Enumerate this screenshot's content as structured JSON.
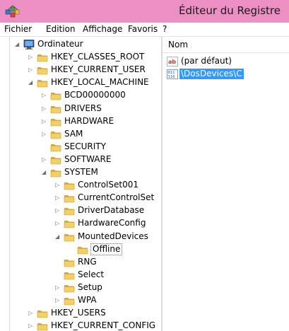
{
  "window": {
    "title": "Éditeur du Registre",
    "icon": "registry-editor-icon",
    "titlebar_color": "#ec8fc5"
  },
  "menu": [
    "Fichier",
    "Edition",
    "Affichage",
    "Favoris",
    "?"
  ],
  "tree": [
    {
      "label": "Ordinateur",
      "depth": 0,
      "state": "expanded",
      "icon": "computer-icon"
    },
    {
      "label": "HKEY_CLASSES_ROOT",
      "depth": 1,
      "state": "collapsed",
      "icon": "folder-icon"
    },
    {
      "label": "HKEY_CURRENT_USER",
      "depth": 1,
      "state": "collapsed",
      "icon": "folder-icon"
    },
    {
      "label": "HKEY_LOCAL_MACHINE",
      "depth": 1,
      "state": "expanded",
      "icon": "folder-icon"
    },
    {
      "label": "BCD00000000",
      "depth": 2,
      "state": "collapsed",
      "icon": "folder-icon"
    },
    {
      "label": "DRIVERS",
      "depth": 2,
      "state": "collapsed",
      "icon": "folder-icon"
    },
    {
      "label": "HARDWARE",
      "depth": 2,
      "state": "collapsed",
      "icon": "folder-icon"
    },
    {
      "label": "SAM",
      "depth": 2,
      "state": "collapsed",
      "icon": "folder-icon"
    },
    {
      "label": "SECURITY",
      "depth": 2,
      "state": "none",
      "icon": "folder-icon"
    },
    {
      "label": "SOFTWARE",
      "depth": 2,
      "state": "collapsed",
      "icon": "folder-icon"
    },
    {
      "label": "SYSTEM",
      "depth": 2,
      "state": "expanded",
      "icon": "folder-icon"
    },
    {
      "label": "ControlSet001",
      "depth": 3,
      "state": "collapsed",
      "icon": "folder-icon"
    },
    {
      "label": "CurrentControlSet",
      "depth": 3,
      "state": "collapsed",
      "icon": "folder-icon"
    },
    {
      "label": "DriverDatabase",
      "depth": 3,
      "state": "collapsed",
      "icon": "folder-icon"
    },
    {
      "label": "HardwareConfig",
      "depth": 3,
      "state": "collapsed",
      "icon": "folder-icon"
    },
    {
      "label": "MountedDevices",
      "depth": 3,
      "state": "expanded",
      "icon": "folder-icon"
    },
    {
      "label": "Offline",
      "depth": 4,
      "state": "none",
      "icon": "folder-icon",
      "selected": true
    },
    {
      "label": "RNG",
      "depth": 3,
      "state": "none",
      "icon": "folder-icon"
    },
    {
      "label": "Select",
      "depth": 3,
      "state": "none",
      "icon": "folder-icon"
    },
    {
      "label": "Setup",
      "depth": 3,
      "state": "collapsed",
      "icon": "folder-icon"
    },
    {
      "label": "WPA",
      "depth": 3,
      "state": "collapsed",
      "icon": "folder-icon"
    },
    {
      "label": "HKEY_USERS",
      "depth": 1,
      "state": "collapsed",
      "icon": "folder-icon"
    },
    {
      "label": "HKEY_CURRENT_CONFIG",
      "depth": 1,
      "state": "collapsed",
      "icon": "folder-icon"
    }
  ],
  "values_pane": {
    "column_name": "Nom",
    "rows": [
      {
        "name": "(par défaut)",
        "icon": "string-value-icon",
        "selected": false
      },
      {
        "name": "\\DosDevices\\C",
        "icon": "binary-value-icon",
        "selected": true
      }
    ]
  },
  "colors": {
    "selection": "#3399ff",
    "folder": "#e8c15a"
  }
}
